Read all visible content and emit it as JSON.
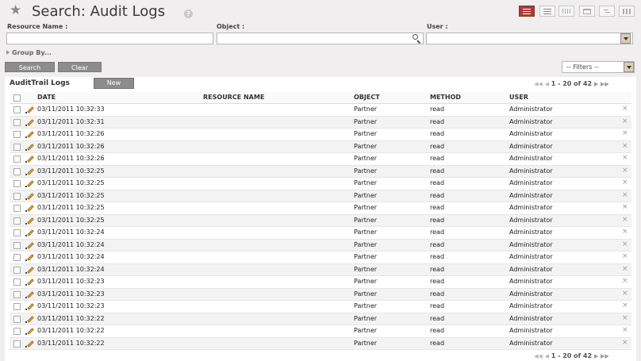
{
  "header": {
    "title": "Search: Audit Logs",
    "help_label": "?"
  },
  "view_switches": [
    "list-view",
    "form-view",
    "graph-view",
    "calendar-view",
    "gantt-view",
    "kanban-view"
  ],
  "search": {
    "resource_name_label": "Resource Name :",
    "resource_name_value": "",
    "object_label": "Object :",
    "object_value": "",
    "user_label": "User :",
    "user_value": "",
    "group_by_label": "Group By...",
    "search_button": "Search",
    "clear_button": "Clear",
    "filters_value": "-- Filters --"
  },
  "list": {
    "title": "AuditTrail Logs",
    "new_button": "New",
    "pager_text": "1 - 20 of 42",
    "pager_nav": {
      "first": "◀◀",
      "prev": "◀",
      "next": "▶",
      "last": "▶▶"
    },
    "columns": {
      "date": "DATE",
      "resource_name": "RESOURCE NAME",
      "object": "OBJECT",
      "method": "METHOD",
      "user": "USER"
    },
    "delete_glyph": "×",
    "rows": [
      {
        "date": "03/11/2011 10:32:33",
        "resource_name": "",
        "object": "Partner",
        "method": "read",
        "user": "Administrator"
      },
      {
        "date": "03/11/2011 10:32:31",
        "resource_name": "",
        "object": "Partner",
        "method": "read",
        "user": "Administrator"
      },
      {
        "date": "03/11/2011 10:32:26",
        "resource_name": "",
        "object": "Partner",
        "method": "read",
        "user": "Administrator"
      },
      {
        "date": "03/11/2011 10:32:26",
        "resource_name": "",
        "object": "Partner",
        "method": "read",
        "user": "Administrator"
      },
      {
        "date": "03/11/2011 10:32:26",
        "resource_name": "",
        "object": "Partner",
        "method": "read",
        "user": "Administrator"
      },
      {
        "date": "03/11/2011 10:32:25",
        "resource_name": "",
        "object": "Partner",
        "method": "read",
        "user": "Administrator"
      },
      {
        "date": "03/11/2011 10:32:25",
        "resource_name": "",
        "object": "Partner",
        "method": "read",
        "user": "Administrator"
      },
      {
        "date": "03/11/2011 10:32:25",
        "resource_name": "",
        "object": "Partner",
        "method": "read",
        "user": "Administrator"
      },
      {
        "date": "03/11/2011 10:32:25",
        "resource_name": "",
        "object": "Partner",
        "method": "read",
        "user": "Administrator"
      },
      {
        "date": "03/11/2011 10:32:25",
        "resource_name": "",
        "object": "Partner",
        "method": "read",
        "user": "Administrator"
      },
      {
        "date": "03/11/2011 10:32:24",
        "resource_name": "",
        "object": "Partner",
        "method": "read",
        "user": "Administrator"
      },
      {
        "date": "03/11/2011 10:32:24",
        "resource_name": "",
        "object": "Partner",
        "method": "read",
        "user": "Administrator"
      },
      {
        "date": "03/11/2011 10:32:24",
        "resource_name": "",
        "object": "Partner",
        "method": "read",
        "user": "Administrator"
      },
      {
        "date": "03/11/2011 10:32:24",
        "resource_name": "",
        "object": "Partner",
        "method": "read",
        "user": "Administrator"
      },
      {
        "date": "03/11/2011 10:32:23",
        "resource_name": "",
        "object": "Partner",
        "method": "read",
        "user": "Administrator"
      },
      {
        "date": "03/11/2011 10:32:23",
        "resource_name": "",
        "object": "Partner",
        "method": "read",
        "user": "Administrator"
      },
      {
        "date": "03/11/2011 10:32:23",
        "resource_name": "",
        "object": "Partner",
        "method": "read",
        "user": "Administrator"
      },
      {
        "date": "03/11/2011 10:32:22",
        "resource_name": "",
        "object": "Partner",
        "method": "read",
        "user": "Administrator"
      },
      {
        "date": "03/11/2011 10:32:22",
        "resource_name": "",
        "object": "Partner",
        "method": "read",
        "user": "Administrator"
      },
      {
        "date": "03/11/2011 10:32:22",
        "resource_name": "",
        "object": "Partner",
        "method": "read",
        "user": "Administrator"
      }
    ]
  },
  "colors": {
    "active_view": "#a83c38",
    "button_bg": "#8c8c8c",
    "page_bg": "#f0eeee"
  }
}
